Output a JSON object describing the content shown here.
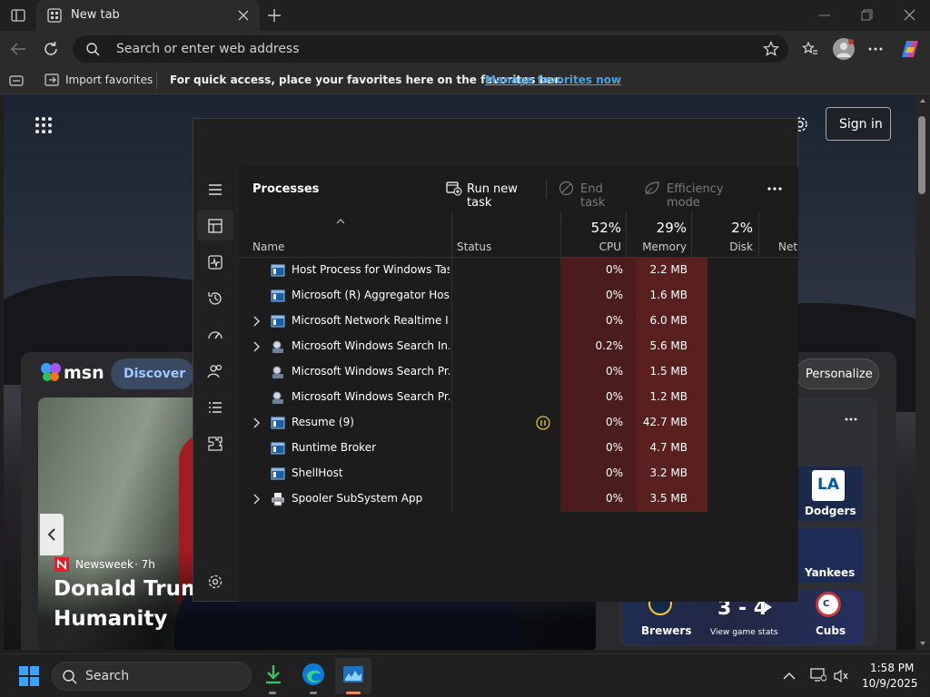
{
  "browser": {
    "tab_title": "New tab",
    "address_placeholder": "Search or enter web address",
    "favbar": {
      "import_label": "Import favorites",
      "message": "For quick access, place your favorites here on the favorites bar.",
      "manage_link": "Manage favorites now"
    }
  },
  "msn": {
    "logo_text": "msn",
    "discover_label": "Discover",
    "signin_label": "Sign in",
    "personalize_label": "Personalize",
    "news": {
      "source": "Newsweek",
      "age": "· 7h",
      "headline_line1": "Donald Trump",
      "headline_line2": "Humanity"
    },
    "sports": {
      "teams": [
        "Dodgers",
        "Yankees",
        "Brewers",
        "Cubs"
      ],
      "score": "3 - 4",
      "game_stats_label": "View game stats"
    }
  },
  "task_manager": {
    "section_title": "Processes",
    "run_new_task": "Run new task",
    "end_task": "End task",
    "efficiency_mode": "Efficiency mode",
    "columns": {
      "name": "Name",
      "status": "Status",
      "cpu_pct": "52%",
      "cpu": "CPU",
      "memory_pct": "29%",
      "memory": "Memory",
      "disk_pct": "2%",
      "disk": "Disk",
      "network": "Netw"
    },
    "processes": [
      {
        "name": "Host Process for Windows Tasks",
        "cpu": "0%",
        "memory": "2.2 MB",
        "expandable": false,
        "icon": "window-app-icon"
      },
      {
        "name": "Microsoft (R) Aggregator Host",
        "cpu": "0%",
        "memory": "1.6 MB",
        "expandable": false,
        "icon": "window-app-icon"
      },
      {
        "name": "Microsoft Network Realtime I...",
        "cpu": "0%",
        "memory": "6.0 MB",
        "expandable": true,
        "icon": "window-app-icon"
      },
      {
        "name": "Microsoft Windows Search In...",
        "cpu": "0.2%",
        "memory": "5.6 MB",
        "expandable": true,
        "icon": "search-indexer-icon"
      },
      {
        "name": "Microsoft Windows Search Pr...",
        "cpu": "0%",
        "memory": "1.5 MB",
        "expandable": false,
        "icon": "search-indexer-icon"
      },
      {
        "name": "Microsoft Windows Search Pr...",
        "cpu": "0%",
        "memory": "1.2 MB",
        "expandable": false,
        "icon": "search-indexer-icon"
      },
      {
        "name": "Resume (9)",
        "cpu": "0%",
        "memory": "42.7 MB",
        "expandable": true,
        "icon": "window-app-icon",
        "status": "paused"
      },
      {
        "name": "Runtime Broker",
        "cpu": "0%",
        "memory": "4.7 MB",
        "expandable": false,
        "icon": "window-app-icon"
      },
      {
        "name": "ShellHost",
        "cpu": "0%",
        "memory": "3.2 MB",
        "expandable": false,
        "icon": "window-app-icon"
      },
      {
        "name": "Spooler SubSystem App",
        "cpu": "0%",
        "memory": "3.5 MB",
        "expandable": true,
        "icon": "printer-icon"
      }
    ]
  },
  "taskbar": {
    "search_label": "Search",
    "time": "1:58 PM",
    "date": "10/9/2025"
  },
  "colors": {
    "accent": "#0078d4",
    "cpu_heat": "#4a1c1c",
    "mem_heat": "#5a1f1f",
    "link": "#4ca0e0"
  }
}
